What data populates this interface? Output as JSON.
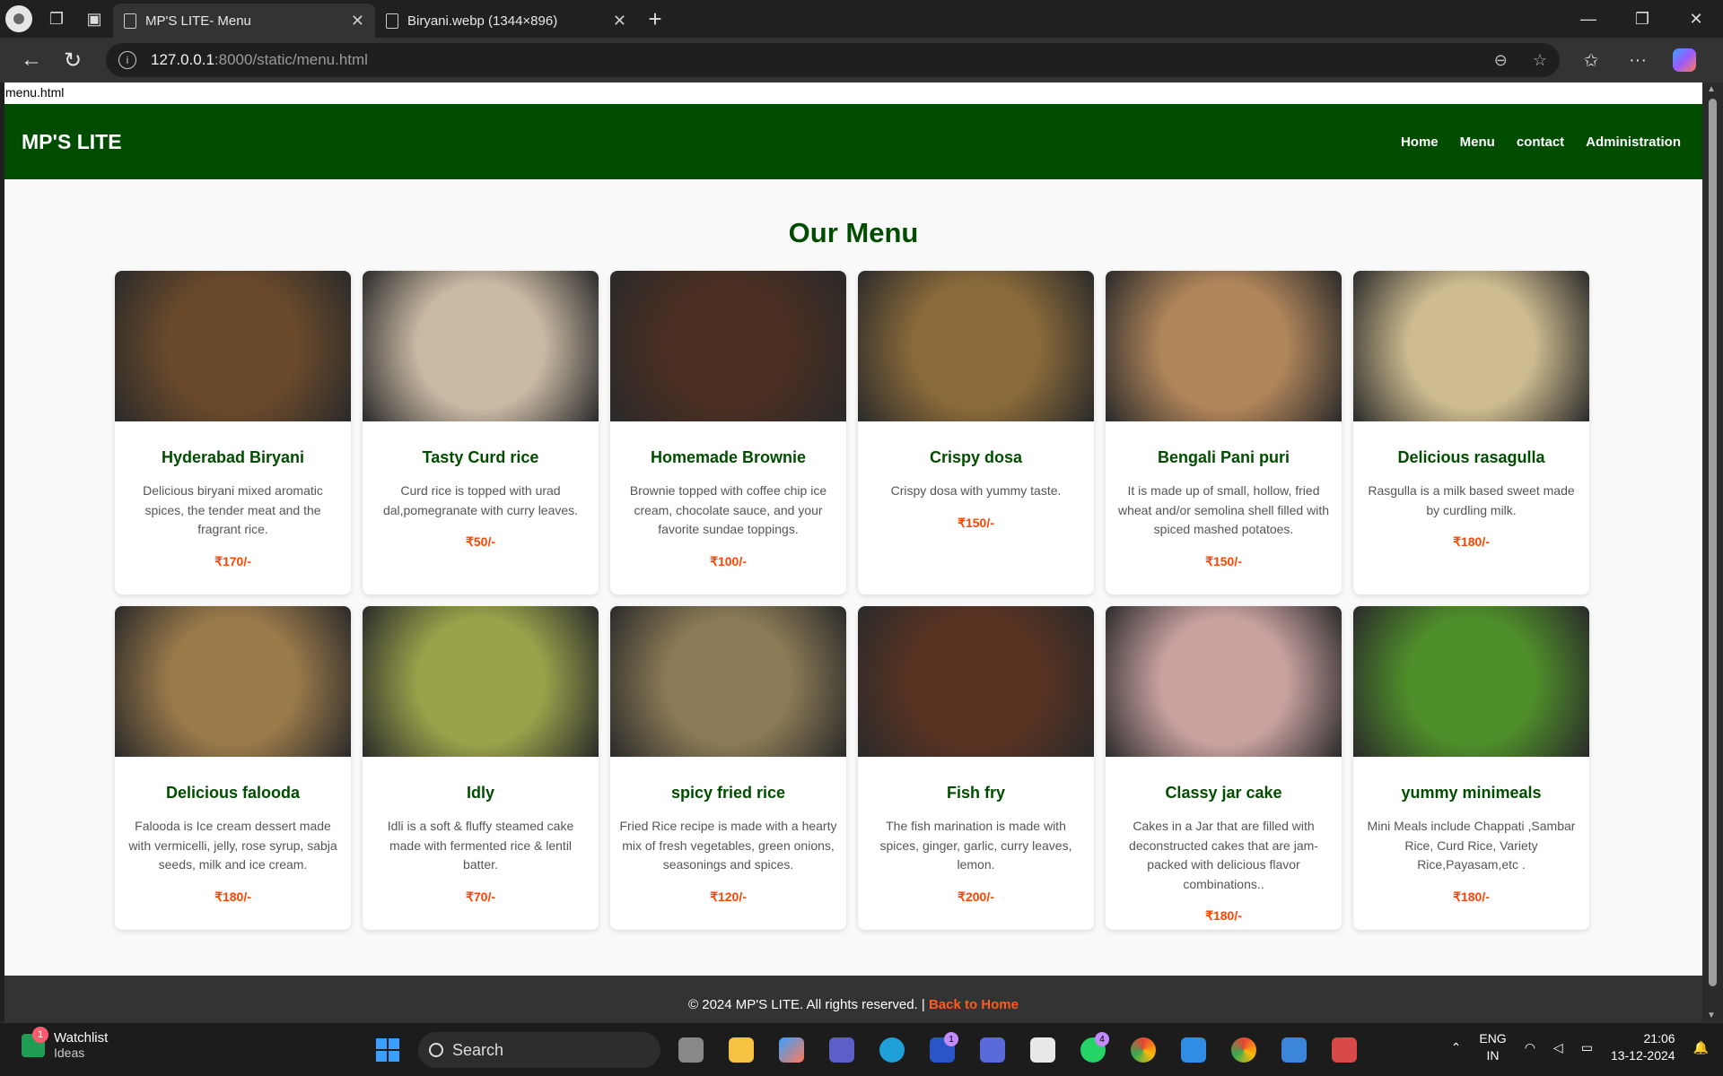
{
  "browser": {
    "tabs": [
      {
        "title": "MP'S LITE- Menu",
        "active": true
      },
      {
        "title": "Biryani.webp (1344×896)",
        "active": false
      }
    ],
    "url_host": "127.0.0.1",
    "url_path": ":8000/static/menu.html"
  },
  "page": {
    "file_label": "menu.html",
    "logo": "MP'S LITE",
    "nav": [
      "Home",
      "Menu",
      "contact",
      "Administration"
    ],
    "title": "Our Menu",
    "items": [
      {
        "name": "Hyderabad Biryani",
        "desc": "Delicious biryani mixed aromatic spices, the tender meat and the fragrant rice.",
        "price": "₹170/-",
        "color": "#6b4a2b"
      },
      {
        "name": "Tasty Curd rice",
        "desc": "Curd rice is topped with urad dal,pomegranate with curry leaves.",
        "price": "₹50/-",
        "color": "#c9b9a4"
      },
      {
        "name": "Homemade Brownie",
        "desc": "Brownie topped with coffee chip ice cream, chocolate sauce, and your favorite sundae toppings.",
        "price": "₹100/-",
        "color": "#4a2e22"
      },
      {
        "name": "Crispy dosa",
        "desc": "Crispy dosa with yummy taste.",
        "price": "₹150/-",
        "color": "#8a6a3a"
      },
      {
        "name": "Bengali Pani puri",
        "desc": "It is made up of small, hollow, fried wheat and/or semolina shell filled with spiced mashed potatoes.",
        "price": "₹150/-",
        "color": "#b0855a"
      },
      {
        "name": "Delicious rasagulla",
        "desc": "Rasgulla is a milk based sweet made by curdling milk.",
        "price": "₹180/-",
        "color": "#cdbb8f"
      },
      {
        "name": "Delicious falooda",
        "desc": "Falooda is Ice cream dessert made with vermicelli, jelly, rose syrup, sabja seeds, milk and ice cream.",
        "price": "₹180/-",
        "color": "#9b7a4a"
      },
      {
        "name": "Idly",
        "desc": "Idli is a soft & fluffy steamed cake made with fermented rice & lentil batter.",
        "price": "₹70/-",
        "color": "#9aa24a"
      },
      {
        "name": "spicy fried rice",
        "desc": "Fried Rice recipe is made with a hearty mix of fresh vegetables, green onions, seasonings and spices.",
        "price": "₹120/-",
        "color": "#8a7a55"
      },
      {
        "name": "Fish fry",
        "desc": "The fish marination is made with spices, ginger, garlic, curry leaves, lemon.",
        "price": "₹200/-",
        "color": "#5a3322"
      },
      {
        "name": "Classy jar cake",
        "desc": "Cakes in a Jar that are filled with deconstructed cakes that are jam-packed with delicious flavor combinations..",
        "price": "₹180/-",
        "color": "#c9a2a0"
      },
      {
        "name": "yummy minimeals",
        "desc": "Mini Meals include Chappati ,Sambar Rice, Curd Rice, Variety Rice,Payasam,etc .",
        "price": "₹180/-",
        "color": "#4f8f2a"
      }
    ],
    "footer_text": "© 2024 MP'S LITE. All rights reserved. | ",
    "footer_link": "Back to Home"
  },
  "taskbar": {
    "watchlist_title": "Watchlist",
    "watchlist_sub": "Ideas",
    "watchlist_badge": "1",
    "search_label": "Search",
    "lang_line1": "ENG",
    "lang_line2": "IN",
    "time": "21:06",
    "date": "13-12-2024"
  },
  "colors": {
    "header_green": "#004d00",
    "price_orange": "#ff4500",
    "footer_bg": "#333333"
  }
}
